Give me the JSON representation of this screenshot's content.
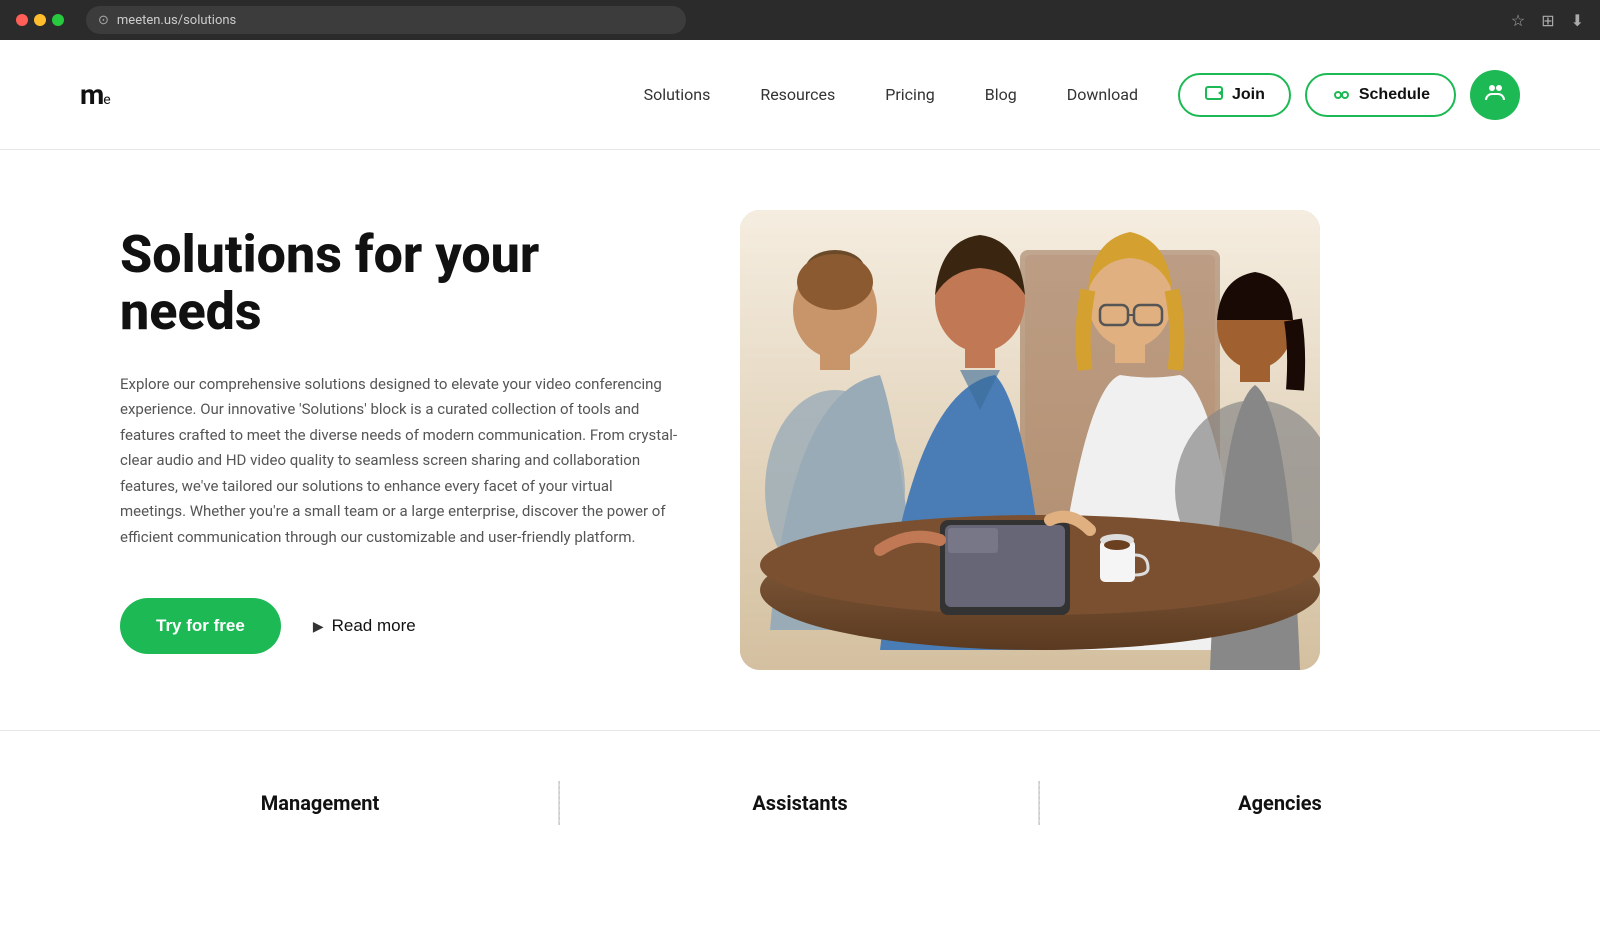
{
  "browser": {
    "url": "meeten.us/solutions",
    "favicon": "●"
  },
  "header": {
    "logo": "me",
    "logo_sub": "e",
    "nav": {
      "items": [
        {
          "id": "solutions",
          "label": "Solutions"
        },
        {
          "id": "resources",
          "label": "Resources"
        },
        {
          "id": "pricing",
          "label": "Pricing"
        },
        {
          "id": "blog",
          "label": "Blog"
        },
        {
          "id": "download",
          "label": "Download"
        }
      ]
    },
    "actions": {
      "join_label": "Join",
      "schedule_label": "Schedule"
    }
  },
  "hero": {
    "title": "Solutions for your needs",
    "description": "Explore our comprehensive solutions designed to elevate your video conferencing experience. Our innovative 'Solutions' block is a curated collection of tools and features crafted to meet the diverse needs of modern communication. From crystal-clear audio and HD video quality to seamless screen sharing and collaboration features, we've tailored our solutions to enhance every facet of your virtual meetings. Whether you're a small team or a large enterprise, discover the power of efficient communication through our customizable and user-friendly platform.",
    "cta_primary": "Try for free",
    "cta_secondary": "Read more"
  },
  "bottom": {
    "items": [
      {
        "id": "management",
        "label": "Management"
      },
      {
        "id": "assistants",
        "label": "Assistants"
      },
      {
        "id": "agencies",
        "label": "Agencies"
      }
    ]
  },
  "colors": {
    "green": "#1db954",
    "dark": "#111111",
    "gray": "#555555",
    "light_gray": "#e8e8e8"
  }
}
